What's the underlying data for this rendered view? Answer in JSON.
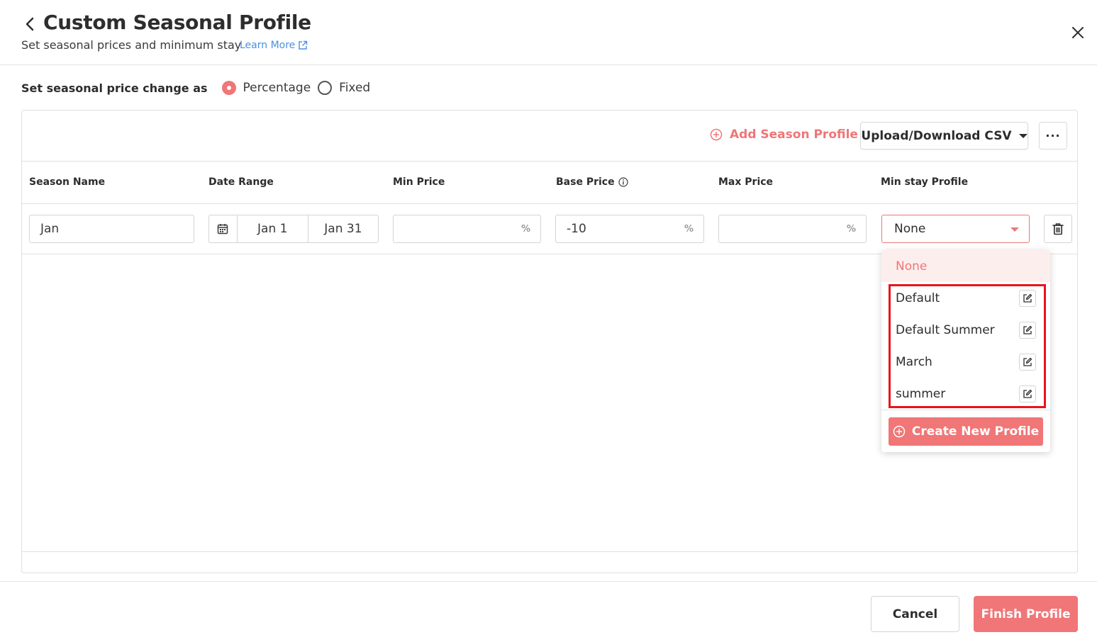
{
  "header": {
    "title": "Custom Seasonal Profile",
    "subtitle": "Set seasonal prices and minimum stay",
    "learn_more": "Learn More"
  },
  "price_mode": {
    "label": "Set seasonal price change as",
    "options": [
      {
        "label": "Percentage",
        "selected": true
      },
      {
        "label": "Fixed",
        "selected": false
      }
    ]
  },
  "toolbar": {
    "add_season": "Add Season Profile",
    "csv": "Upload/Download CSV",
    "more": "···"
  },
  "table": {
    "columns": [
      "Season Name",
      "Date Range",
      "Min Price",
      "Base Price",
      "Max Price",
      "Min stay Profile"
    ],
    "rows": [
      {
        "season_name": "Jan",
        "date_start": "Jan 1",
        "date_end": "Jan 31",
        "min_price": "",
        "base_price": "-10",
        "max_price": "",
        "suffix": "%",
        "min_stay_profile": "None"
      }
    ]
  },
  "dropdown": {
    "selected": "None",
    "items": [
      "Default",
      "Default Summer",
      "March",
      "summer"
    ],
    "create": "Create New Profile"
  },
  "footer": {
    "cancel": "Cancel",
    "finish": "Finish Profile"
  },
  "colors": {
    "accent": "#f07677",
    "link": "#4a90e2",
    "highlight_box": "#e8141a"
  }
}
